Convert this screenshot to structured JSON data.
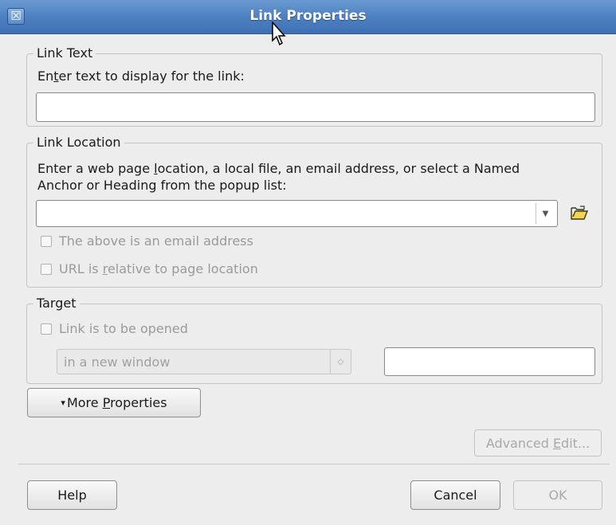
{
  "window": {
    "title": "Link Properties",
    "close_glyph": "☒"
  },
  "link_text": {
    "legend": "Link Text",
    "prompt_before": "En",
    "prompt_mnemonic": "t",
    "prompt_after": "er text to display for the link:",
    "value": ""
  },
  "link_location": {
    "legend": "Link Location",
    "prompt_line1_before": "Enter a web page ",
    "prompt_line1_mnemonic": "l",
    "prompt_line1_after": "ocation, a local file, an email address, or select a Named",
    "prompt_line2": "Anchor or Heading from the popup list:",
    "url_value": "",
    "dropdown_glyph": "▼",
    "browse_icon": "open-folder-icon",
    "email_checkbox_label": "The above is an email address",
    "relative_checkbox_before": "URL is ",
    "relative_checkbox_mnemonic": "r",
    "relative_checkbox_after": "elative to page location"
  },
  "target": {
    "legend": "Target",
    "open_checkbox_label": "Link is to be opened",
    "window_select_value": "in a new window",
    "spin_glyph": "◇",
    "target_name_value": ""
  },
  "buttons": {
    "more_properties_arrow": "▾",
    "more_properties_before": "More ",
    "more_properties_mnemonic": "P",
    "more_properties_after": "roperties",
    "advanced_edit_before": "Advanced ",
    "advanced_edit_mnemonic": "E",
    "advanced_edit_after": "dit...",
    "help": "Help",
    "cancel": "Cancel",
    "ok": "OK"
  },
  "colors": {
    "titlebar": "#4d81c2",
    "background": "#ededed",
    "disabled_text": "#a0a0a0"
  }
}
